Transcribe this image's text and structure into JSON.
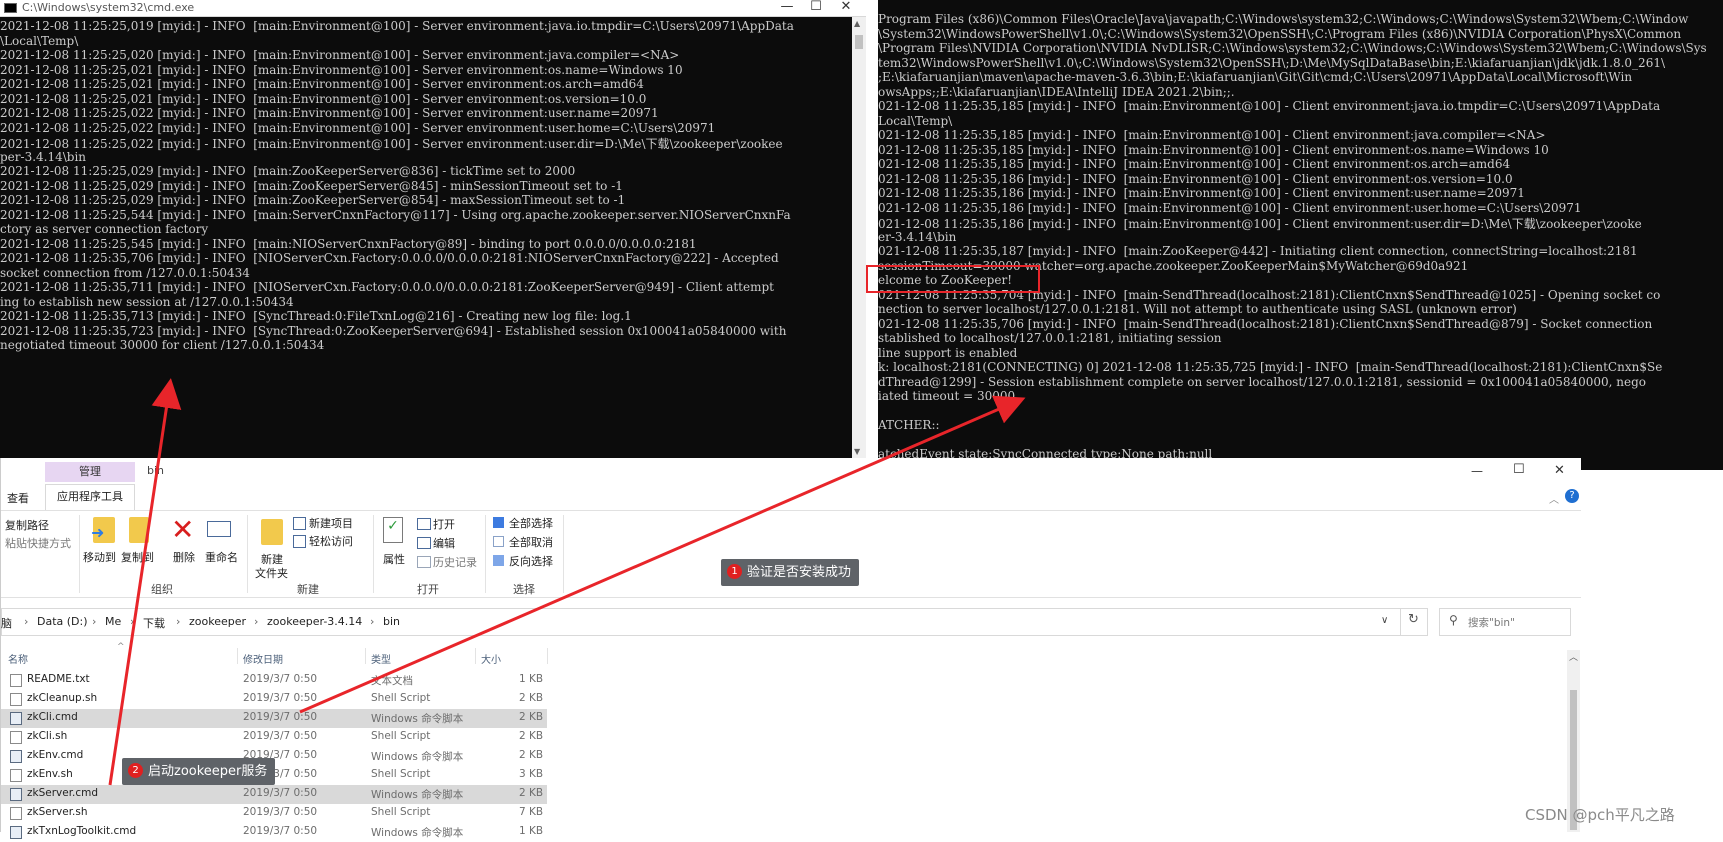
{
  "left_console": {
    "title": "C:\\Windows\\system32\\cmd.exe",
    "lines": [
      "2021-12-08 11:25:25,019 [myid:] - INFO  [main:Environment@100] - Server environment:java.io.tmpdir=C:\\Users\\20971\\AppData",
      "\\Local\\Temp\\",
      "2021-12-08 11:25:25,020 [myid:] - INFO  [main:Environment@100] - Server environment:java.compiler=<NA>",
      "2021-12-08 11:25:25,021 [myid:] - INFO  [main:Environment@100] - Server environment:os.name=Windows 10",
      "2021-12-08 11:25:25,021 [myid:] - INFO  [main:Environment@100] - Server environment:os.arch=amd64",
      "2021-12-08 11:25:25,021 [myid:] - INFO  [main:Environment@100] - Server environment:os.version=10.0",
      "2021-12-08 11:25:25,022 [myid:] - INFO  [main:Environment@100] - Server environment:user.name=20971",
      "2021-12-08 11:25:25,022 [myid:] - INFO  [main:Environment@100] - Server environment:user.home=C:\\Users\\20971",
      "2021-12-08 11:25:25,022 [myid:] - INFO  [main:Environment@100] - Server environment:user.dir=D:\\Me\\下载\\zookeeper\\zookee",
      "per-3.4.14\\bin",
      "2021-12-08 11:25:25,029 [myid:] - INFO  [main:ZooKeeperServer@836] - tickTime set to 2000",
      "2021-12-08 11:25:25,029 [myid:] - INFO  [main:ZooKeeperServer@845] - minSessionTimeout set to -1",
      "2021-12-08 11:25:25,029 [myid:] - INFO  [main:ZooKeeperServer@854] - maxSessionTimeout set to -1",
      "2021-12-08 11:25:25,544 [myid:] - INFO  [main:ServerCnxnFactory@117] - Using org.apache.zookeeper.server.NIOServerCnxnFa",
      "ctory as server connection factory",
      "2021-12-08 11:25:25,545 [myid:] - INFO  [main:NIOServerCnxnFactory@89] - binding to port 0.0.0.0/0.0.0.0:2181",
      "2021-12-08 11:25:35,706 [myid:] - INFO  [NIOServerCxn.Factory:0.0.0.0/0.0.0.0:2181:NIOServerCnxnFactory@222] - Accepted",
      "socket connection from /127.0.0.1:50434",
      "2021-12-08 11:25:35,711 [myid:] - INFO  [NIOServerCxn.Factory:0.0.0.0/0.0.0.0:2181:ZooKeeperServer@949] - Client attempt",
      "ing to establish new session at /127.0.0.1:50434",
      "2021-12-08 11:25:35,713 [myid:] - INFO  [SyncThread:0:FileTxnLog@216] - Creating new log file: log.1",
      "2021-12-08 11:25:35,723 [myid:] - INFO  [SyncThread:0:ZooKeeperServer@694] - Established session 0x100041a05840000 with",
      "negotiated timeout 30000 for client /127.0.0.1:50434"
    ]
  },
  "right_console": {
    "lines": [
      "Program Files (x86)\\Common Files\\Oracle\\Java\\javapath;C:\\Windows\\system32;C:\\Windows;C:\\Windows\\System32\\Wbem;C:\\Window",
      "\\System32\\WindowsPowerShell\\v1.0\\;C:\\Windows\\System32\\OpenSSH\\;C:\\Program Files (x86)\\NVIDIA Corporation\\PhysX\\Common",
      "\\Program Files\\NVIDIA Corporation\\NVIDIA NvDLISR;C:\\Windows\\system32;C:\\Windows;C:\\Windows\\System32\\Wbem;C:\\Windows\\Sys",
      "tem32\\WindowsPowerShell\\v1.0\\;C:\\Windows\\System32\\OpenSSH\\;D:\\Me\\MySqlDataBase\\bin;E:\\kiafaruanjian\\jdk\\jdk.1.8.0_261\\",
      ";E:\\kiafaruanjian\\maven\\apache-maven-3.6.3\\bin;E:\\kiafaruanjian\\Git\\Git\\cmd;C:\\Users\\20971\\AppData\\Local\\Microsoft\\Win",
      "owsApps;;E:\\kiafaruanjian\\IDEA\\IntelliJ IDEA 2021.2\\bin;;.",
      "021-12-08 11:25:35,185 [myid:] - INFO  [main:Environment@100] - Client environment:java.io.tmpdir=C:\\Users\\20971\\AppData",
      "Local\\Temp\\",
      "021-12-08 11:25:35,185 [myid:] - INFO  [main:Environment@100] - Client environment:java.compiler=<NA>",
      "021-12-08 11:25:35,185 [myid:] - INFO  [main:Environment@100] - Client environment:os.name=Windows 10",
      "021-12-08 11:25:35,185 [myid:] - INFO  [main:Environment@100] - Client environment:os.arch=amd64",
      "021-12-08 11:25:35,186 [myid:] - INFO  [main:Environment@100] - Client environment:os.version=10.0",
      "021-12-08 11:25:35,186 [myid:] - INFO  [main:Environment@100] - Client environment:user.name=20971",
      "021-12-08 11:25:35,186 [myid:] - INFO  [main:Environment@100] - Client environment:user.home=C:\\Users\\20971",
      "021-12-08 11:25:35,186 [myid:] - INFO  [main:Environment@100] - Client environment:user.dir=D:\\Me\\下载\\zookeeper\\zooke",
      "er-3.4.14\\bin",
      "021-12-08 11:25:35,187 [myid:] - INFO  [main:ZooKeeper@442] - Initiating client connection, connectString=localhost:2181",
      "sessionTimeout=30000 watcher=org.apache.zookeeper.ZooKeeperMain$MyWatcher@69d0a921",
      "elcome to ZooKeeper!",
      "021-12-08 11:25:35,704 [myid:] - INFO  [main-SendThread(localhost:2181):ClientCnxn$SendThread@1025] - Opening socket co",
      "nection to server localhost/127.0.0.1:2181. Will not attempt to authenticate using SASL (unknown error)",
      "021-12-08 11:25:35,706 [myid:] - INFO  [main-SendThread(localhost:2181):ClientCnxn$SendThread@879] - Socket connection",
      "stablished to localhost/127.0.0.1:2181, initiating session",
      "line support is enabled",
      "k: localhost:2181(CONNECTING) 0] 2021-12-08 11:25:35,725 [myid:] - INFO  [main-SendThread(localhost:2181):ClientCnxn$Se",
      "dThread@1299] - Session establishment complete on server localhost/127.0.0.1:2181, sessionid = 0x100041a05840000, nego",
      "iated timeout = 30000",
      "",
      "ATCHER::",
      "",
      "atchedEvent state:SyncConnected type:None path:null"
    ]
  },
  "explorer": {
    "ribbon_tabs": {
      "manage": "管理",
      "bin": "bin",
      "view": "查看",
      "app_tools": "应用程序工具"
    },
    "window_controls": {
      "minimize": "—",
      "maximize": "☐",
      "close": "✕"
    },
    "ribbon": {
      "copy_path": "复制路径",
      "paste_shortcut": "粘贴快捷方式",
      "move_to": "移动到",
      "copy_to": "复制到",
      "delete": "删除",
      "rename": "重命名",
      "new_folder_1": "新建",
      "new_folder_2": "文件夹",
      "new_item": "新建项目",
      "easy_access": "轻松访问",
      "properties": "属性",
      "open": "打开",
      "edit": "编辑",
      "history": "历史记录",
      "select_all": "全部选择",
      "select_none": "全部取消",
      "invert_select": "反向选择",
      "group_organize": "组织",
      "group_new": "新建",
      "group_open": "打开",
      "group_select": "选择"
    },
    "address": {
      "crumbs": [
        "脑",
        "Data (D:)",
        "Me",
        "下载",
        "zookeeper",
        "zookeeper-3.4.14",
        "bin"
      ],
      "search_placeholder": "搜索\"bin\""
    },
    "columns": {
      "name": "名称",
      "date": "修改日期",
      "type": "类型",
      "size": "大小"
    },
    "files": [
      {
        "name": "README.txt",
        "date": "2019/3/7 0:50",
        "type": "文本文档",
        "size": "1 KB"
      },
      {
        "name": "zkCleanup.sh",
        "date": "2019/3/7 0:50",
        "type": "Shell Script",
        "size": "2 KB"
      },
      {
        "name": "zkCli.cmd",
        "date": "2019/3/7 0:50",
        "type": "Windows 命令脚本",
        "size": "2 KB"
      },
      {
        "name": "zkCli.sh",
        "date": "2019/3/7 0:50",
        "type": "Shell Script",
        "size": "2 KB"
      },
      {
        "name": "zkEnv.cmd",
        "date": "2019/3/7 0:50",
        "type": "Windows 命令脚本",
        "size": "2 KB"
      },
      {
        "name": "zkEnv.sh",
        "date": "2019/3/7 0:50",
        "type": "Shell Script",
        "size": "3 KB"
      },
      {
        "name": "zkServer.cmd",
        "date": "2019/3/7 0:50",
        "type": "Windows 命令脚本",
        "size": "2 KB"
      },
      {
        "name": "zkServer.sh",
        "date": "2019/3/7 0:50",
        "type": "Shell Script",
        "size": "7 KB"
      },
      {
        "name": "zkTxnLogToolkit.cmd",
        "date": "2019/3/7 0:50",
        "type": "Windows 命令脚本",
        "size": "1 KB"
      }
    ]
  },
  "annotations": {
    "callout1": {
      "num": "1",
      "text": "验证是否安装成功"
    },
    "callout2": {
      "num": "2",
      "text": "启动zookeeper服务"
    },
    "arrow_color": "#e8252a"
  },
  "watermark": "CSDN @pch平凡之路",
  "colors": {
    "console_bg": "#0c0c0c",
    "console_text": "#cccccc",
    "selected_row": "#d9d9d9",
    "manage_tab": "#e7d6f2"
  }
}
